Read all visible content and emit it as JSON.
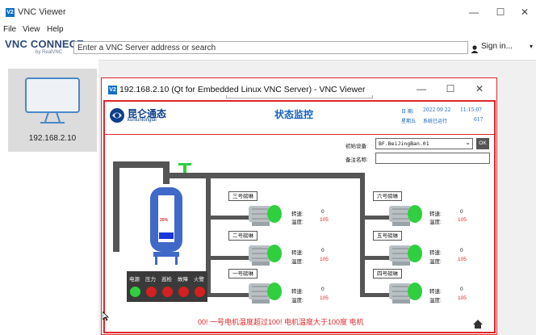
{
  "app": {
    "title": "VNC Viewer"
  },
  "menu": [
    "File",
    "View",
    "Help"
  ],
  "brand": {
    "line1": "VNC CONNECT",
    "line2": "by RealVNC"
  },
  "address_bar": {
    "placeholder": "Enter a VNC Server address or search"
  },
  "signin": {
    "label": "Sign in..."
  },
  "connections": [
    {
      "label": "192.168.2.10"
    }
  ],
  "vnc": {
    "title": "192.168.2.10 (Qt for Embedded Linux VNC Server) - VNC Viewer",
    "brand_name": "昆仑通态",
    "brand_sub": "kunluntongtai",
    "screen_title": "状态监控",
    "date_label": "日 期:",
    "date_value": "2022 09 22",
    "time_value": "11:15:07",
    "weekday_label": "星期五",
    "system_label": "系统已运行",
    "uptime": "617",
    "device_label": "初始设备:",
    "device_value": "BF.BeiJingBan.01",
    "ok": "OK",
    "note_label": "备注名称:",
    "pumps": [
      {
        "name": "三号磅琳",
        "speed": "0",
        "temp": "105"
      },
      {
        "name": "二号磅琳",
        "speed": "0",
        "temp": "105"
      },
      {
        "name": "一号磅琳",
        "speed": "0",
        "temp": "105"
      },
      {
        "name": "六号磅琳",
        "speed": "0",
        "temp": "105"
      },
      {
        "name": "五号磅琳",
        "speed": "0",
        "temp": "105"
      },
      {
        "name": "四号磅琳",
        "speed": "0",
        "temp": "105"
      }
    ],
    "speed_label": "转速:",
    "temp_label": "温度:",
    "tank_level": "20%",
    "tank_fill_fraction": 0.2,
    "status_labels": [
      "电源",
      "压力",
      "巡检",
      "故障",
      "火警"
    ],
    "alarm_text": "00!   一号电机温度超过100!   电机温度大于100度   电机"
  }
}
